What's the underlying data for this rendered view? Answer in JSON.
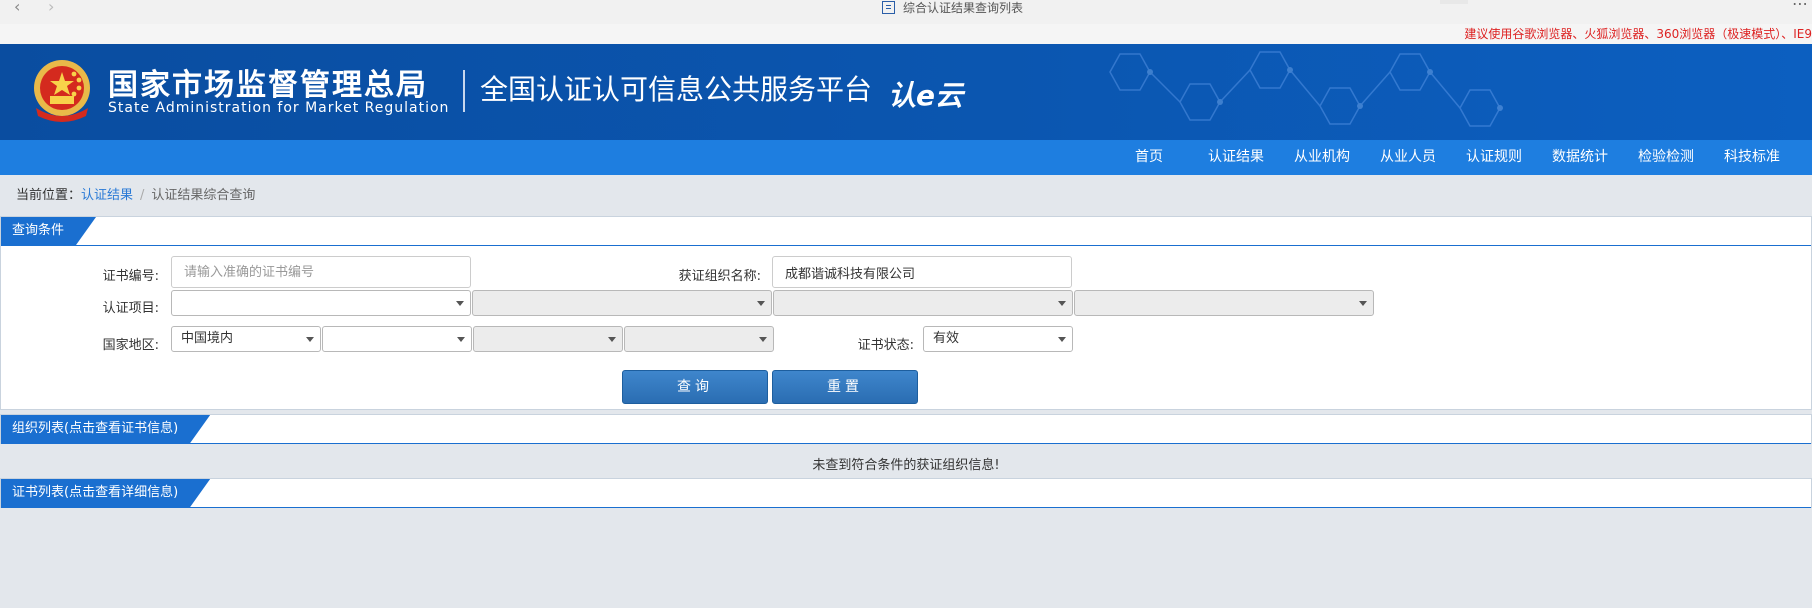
{
  "browser": {
    "tab_title": "综合认证结果查询列表",
    "back_icon": "chevron-left-icon",
    "forward_icon": "chevron-right-icon",
    "menu_icon": "more-icon",
    "menu_glyph": "⋯"
  },
  "warning": "建议使用谷歌浏览器、火狐浏览器、360浏览器（极速模式）、IE9",
  "header": {
    "agency_cn": "国家市场监督管理总局",
    "agency_en": "State Administration  for  Market Regulation",
    "platform_name": "全国认证认可信息公共服务平台",
    "platform_logo": "认e云"
  },
  "nav": {
    "items": [
      "首页",
      "认证结果",
      "从业机构",
      "从业人员",
      "认证规则",
      "数据统计",
      "检验检测",
      "科技标准"
    ]
  },
  "breadcrumb": {
    "prefix": "当前位置：",
    "link": "认证结果",
    "separator": "/",
    "current": "认证结果综合查询"
  },
  "query": {
    "title": "查询条件",
    "cert_no_label": "证书编号:",
    "cert_no_placeholder": "请输入准确的证书编号",
    "org_name_label": "获证组织名称:",
    "org_name_value": "成都谐诚科技有限公司",
    "project_label": "认证项目:",
    "region_label": "国家地区:",
    "region_value": "中国境内",
    "status_label": "证书状态:",
    "status_value": "有效",
    "search_button": "查询",
    "reset_button": "重置"
  },
  "org_list": {
    "title": "组织列表(点击查看证书信息)",
    "empty_message": "未查到符合条件的获证组织信息!"
  },
  "cert_list": {
    "title": "证书列表(点击查看详细信息)"
  },
  "colors": {
    "header_blue": "#0b56b0",
    "nav_blue": "#1e7ee0",
    "panel_tab_blue": "#1a6fd0",
    "warning_red": "#dd2222"
  }
}
